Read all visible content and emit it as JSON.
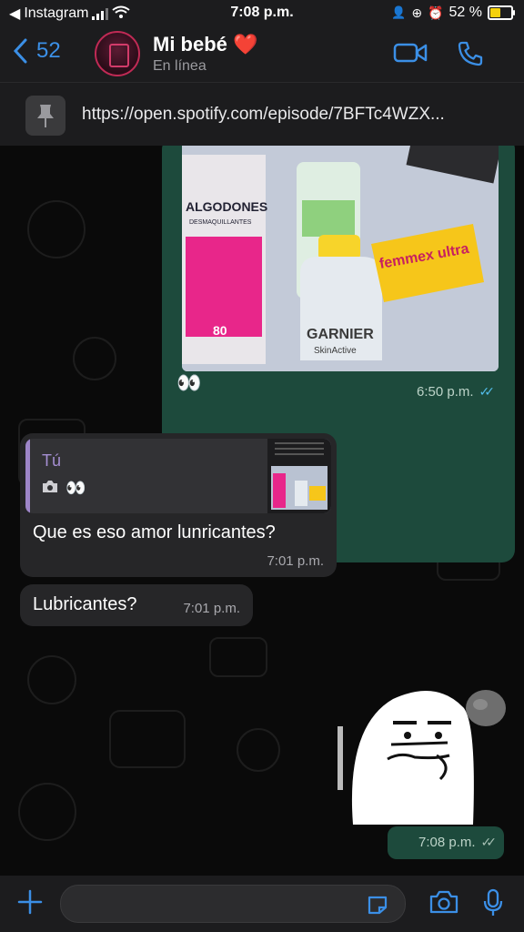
{
  "status_bar": {
    "back_app": "Instagram",
    "time": "7:08 p.m.",
    "battery": "52 %"
  },
  "header": {
    "back_count": "52",
    "contact_name": "Mi bebé ❤️",
    "contact_status": "En línea"
  },
  "pinned": {
    "url": "https://open.spotify.com/episode/7BFTc4WZX..."
  },
  "messages": [
    {
      "type": "image",
      "direction": "outgoing",
      "caption": "👀",
      "time": "6:50 p.m.",
      "photo_labels": [
        "ALGODONES",
        "DESMAQUILLANTES",
        "80",
        "GARNIER",
        "SkinActive",
        "femmex ultra"
      ]
    },
    {
      "type": "reply",
      "direction": "incoming",
      "quote_author": "Tú",
      "quote_preview": "👀",
      "text": "Que es eso amor lunricantes?",
      "time": "7:01 p.m."
    },
    {
      "type": "text",
      "direction": "incoming",
      "text": "Lubricantes?",
      "time": "7:01 p.m."
    },
    {
      "type": "sticker",
      "direction": "outgoing",
      "time": "7:08 p.m."
    }
  ],
  "colors": {
    "accent": "#3b8fe6",
    "outgoing_bubble": "#1d4a3c",
    "incoming_bubble": "#262628",
    "read_ticks": "#53bdeb"
  }
}
